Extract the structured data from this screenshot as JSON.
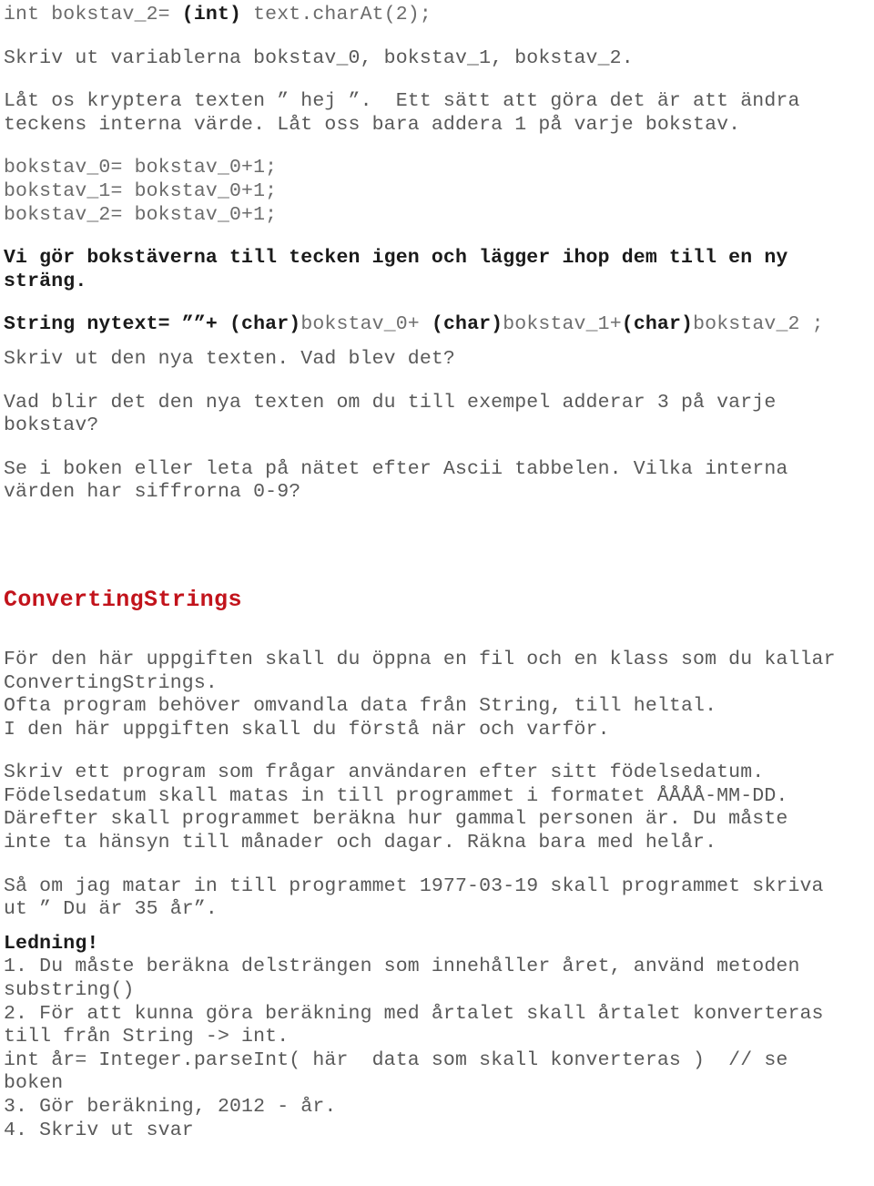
{
  "document": {
    "title": "ConvertingStrings uppgift",
    "accent_color": "#C2131B",
    "body_color": "#595959",
    "bold_color": "#1a1a1a"
  },
  "blocks": {
    "code_charat": {
      "prefix": "int bokstav_2= ",
      "cast": "(int)",
      "suffix": " text.charAt(2);"
    },
    "skriv_ut_variabler": "Skriv ut variablerna bokstav_0, bokstav_1, bokstav_2.",
    "kryptera": "Låt os kryptera texten ” hej ”.  Ett sätt att göra det är att ändra\nteckens interna värde. Låt oss bara addera 1 på varje bokstav.",
    "code_addera": "bokstav_0= bokstav_0+1;\nbokstav_1= bokstav_0+1;\nbokstav_2= bokstav_0+1;",
    "vi_gor_bokstaverna": "Vi gör bokstäverna till tecken igen och lägger ihop dem till en ny\nsträng.",
    "code_nytext": {
      "p1": "String nytext= ””+ ",
      "cast1": "(char)",
      "v1": "bokstav_0+ ",
      "cast2": "(char)",
      "v2": "bokstav_1+",
      "cast3": "(char)",
      "v3": "bokstav_2 ;"
    },
    "skriv_ut_nya_texten": "Skriv ut den nya texten. Vad blev det?",
    "vad_blir_det": "Vad blir det den nya texten om du till exempel adderar 3 på varje\nbokstav?",
    "ascii_tabell": "Se i boken eller leta på nätet efter Ascii tabbelen. Vilka interna\nvärden har siffrorna 0-9?",
    "heading_converting_strings": "ConvertingStrings",
    "uppgift_intro": "För den här uppgiften skall du öppna en fil och en klass som du kallar\nConvertingStrings.\nOfta program behöver omvandla data från String, till heltal.\nI den här uppgiften skall du förstå när och varför.",
    "uppgift_beskrivning": "Skriv ett program som frågar användaren efter sitt födelsedatum.\nFödelsedatum skall matas in till programmet i formatet ÅÅÅÅ-MM-DD.\nDärefter skall programmet beräkna hur gammal personen är. Du måste\ninte ta hänsyn till månader och dagar. Räkna bara med helår.",
    "exempel": "Så om jag matar in till programmet 1977-03-19 skall programmet skriva\nut ” Du är 35 år”.",
    "ledning_heading": "Ledning!",
    "ledning_steps": "1. Du måste beräkna delsträngen som innehåller året, använd metoden\nsubstring()\n2. För att kunna göra beräkning med årtalet skall årtalet konverteras\ntill från String -> int.\nint år= Integer.parseInt( här  data som skall konverteras )  // se\nboken\n3. Gör beräkning, 2012 - år.\n4. Skriv ut svar"
  }
}
